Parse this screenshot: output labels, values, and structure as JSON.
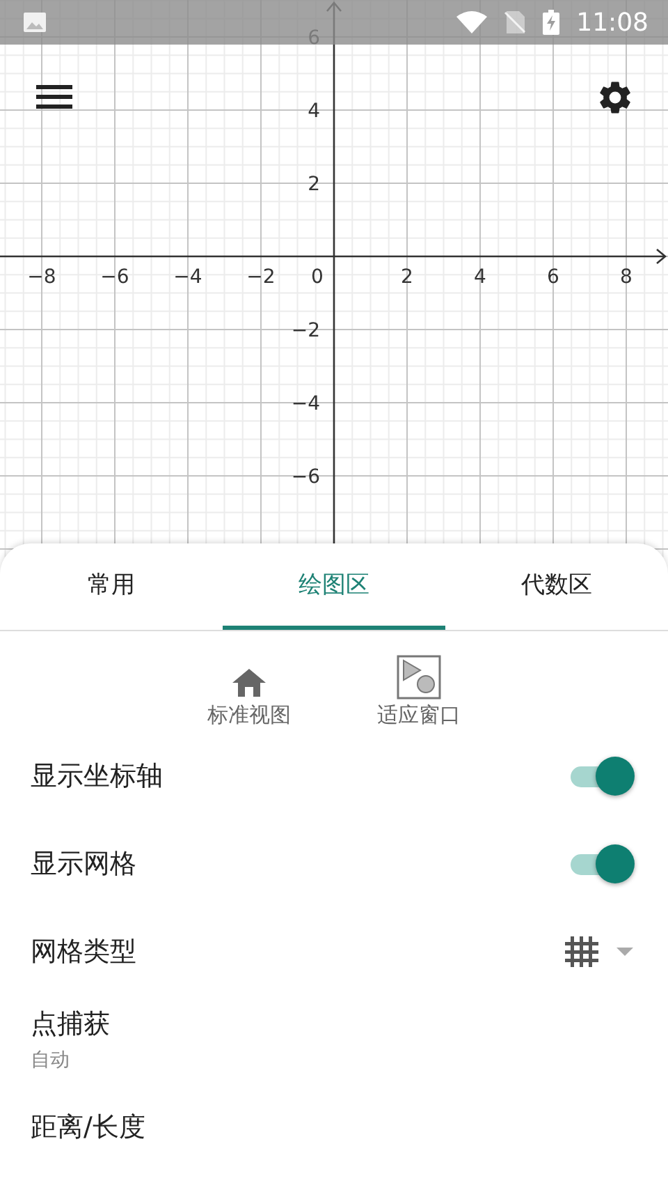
{
  "status_bar": {
    "time": "11:08"
  },
  "graph": {
    "x_labels": [
      "−8",
      "−6",
      "−4",
      "−2",
      "2",
      "4",
      "6",
      "8"
    ],
    "y_labels": [
      "6",
      "4",
      "2",
      "−2",
      "−4",
      "−6"
    ],
    "origin_label": "0"
  },
  "tabs": [
    {
      "label": "常用",
      "selected": false
    },
    {
      "label": "绘图区",
      "selected": true
    },
    {
      "label": "代数区",
      "selected": false
    }
  ],
  "view_buttons": [
    {
      "label": "标准视图",
      "kind": "home"
    },
    {
      "label": "适应窗口",
      "kind": "fit"
    }
  ],
  "settings": [
    {
      "kind": "toggle",
      "label": "显示坐标轴",
      "on": true
    },
    {
      "kind": "toggle",
      "label": "显示网格",
      "on": true
    },
    {
      "kind": "dropdown",
      "label": "网格类型"
    },
    {
      "kind": "subtitle",
      "label": "点捕获",
      "value": "自动"
    },
    {
      "kind": "plain",
      "label": "距离/长度"
    }
  ]
}
